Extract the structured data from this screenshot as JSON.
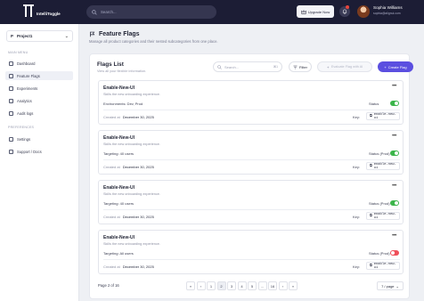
{
  "brand": {
    "name": "IntelliToggle"
  },
  "topbar": {
    "search_placeholder": "Search...",
    "upgrade_label": "Upgrade Now",
    "user_name": "Sophia Williams",
    "user_email": "sophia@alignui.com"
  },
  "sidebar": {
    "project": {
      "initial": "P",
      "name": "Project1"
    },
    "main_menu_label": "MAIN MENU",
    "main_items": [
      {
        "label": "Dashboard",
        "icon": "dashboard-icon"
      },
      {
        "label": "Feature Flags",
        "icon": "flag-icon",
        "active": true
      },
      {
        "label": "Experiments",
        "icon": "flask-icon"
      },
      {
        "label": "Analytics",
        "icon": "chart-icon"
      },
      {
        "label": "Audit logs",
        "icon": "log-icon"
      }
    ],
    "preferences_label": "PREFERENCES",
    "pref_items": [
      {
        "label": "Settings",
        "icon": "gear-icon"
      },
      {
        "label": "Support / Docs",
        "icon": "help-icon"
      }
    ]
  },
  "page": {
    "title": "Feature Flags",
    "subtitle": "Manage all product categories and their nested subcategories from one place."
  },
  "list": {
    "title": "Flags List",
    "subtitle": "View all your flexible information.",
    "search_placeholder": "Search...",
    "search_shortcut": "⌘1",
    "filter_label": "Filter",
    "sfa_label": "Evaluate Flag with AI",
    "create_label": "Create Flag"
  },
  "flags": [
    {
      "name": "Enable-New-UI",
      "description": "Skills the new onboarding experience.",
      "targeting": "Environments: Dev, Prod",
      "status_label": "Status",
      "enabled": true,
      "created_label": "Created at",
      "created_date": "December 30, 2025",
      "key_label": "Key:",
      "key": "enable-new-ui"
    },
    {
      "name": "Enable-New-UI",
      "description": "Skills the new onboarding experience.",
      "targeting": "Targeting: 40 users",
      "status_label": "Status (Prod)",
      "enabled": true,
      "created_label": "Created at",
      "created_date": "December 30, 2025",
      "key_label": "Key:",
      "key": "enable-new-ui"
    },
    {
      "name": "Enable-New-UI",
      "description": "Skills the new onboarding experience.",
      "targeting": "Targeting: 40 users",
      "status_label": "Status (Prod)",
      "enabled": true,
      "created_label": "Created at",
      "created_date": "December 30, 2025",
      "key_label": "Key:",
      "key": "enable-new-ui"
    },
    {
      "name": "Enable-New-UI",
      "description": "Skills the new onboarding experience.",
      "targeting": "Targeting: All users",
      "status_label": "Status (Prod)",
      "enabled": false,
      "created_label": "Created at",
      "created_date": "December 30, 2025",
      "key_label": "Key:",
      "key": "enable-new-ui"
    }
  ],
  "pagination": {
    "label": "Page 2 of 16",
    "buttons": [
      "«",
      "‹",
      "1",
      "2",
      "3",
      "4",
      "5",
      "...",
      "16",
      "›",
      "»"
    ],
    "active": "2",
    "per_page": "7 / page"
  },
  "colors": {
    "topbar": "#1c1d35",
    "accent": "#5b4fe0",
    "toggle_on": "#3bb54a",
    "toggle_off": "#ef4f5a"
  }
}
